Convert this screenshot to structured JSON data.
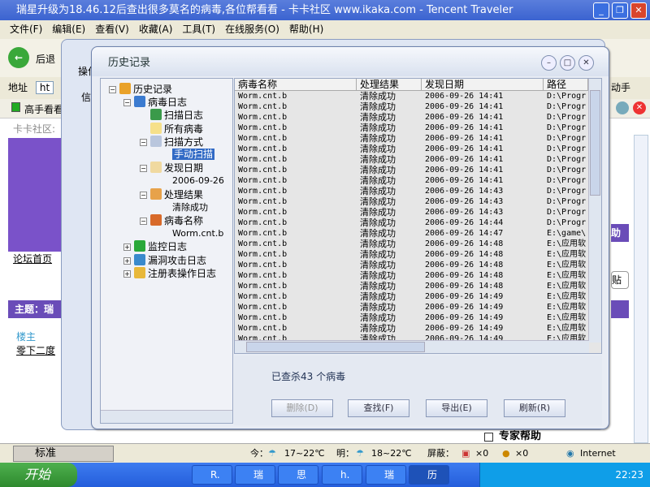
{
  "browser": {
    "title": "瑞星升级为18.46.12后查出很多莫名的病毒,各位帮看看 - 卡卡社区 www.ikaka.com - Tencent Traveler",
    "menu": [
      "文件(F)",
      "编辑(E)",
      "查看(V)",
      "收藏(A)",
      "工具(T)",
      "在线服务(O)",
      "帮助(H)"
    ],
    "back_label": "后退",
    "address_label": "地址",
    "address_value": "ht",
    "tab_label": "高手看看",
    "breadcrumb": "卡卡社区:",
    "forum_home": "论坛首页",
    "topic_label": "主题：瑞",
    "author_role": "楼主",
    "author_name": "零下二度",
    "right_text": "动手",
    "help_text": "助",
    "post_text": "贴",
    "expert_help": "专家帮助",
    "behind_tab": "信",
    "behind_menu": "操作"
  },
  "dialog": {
    "title": "历史记录",
    "tree": [
      {
        "label": "历史记录",
        "icon": "history-icon",
        "expander": "−"
      },
      {
        "label": "病毒日志",
        "icon": "virus-log-icon",
        "expander": "−"
      },
      {
        "label": "扫描日志",
        "icon": "scan-log-icon"
      },
      {
        "label": "所有病毒",
        "icon": "all-virus-icon"
      },
      {
        "label": "扫描方式",
        "icon": "scan-mode-icon",
        "expander": "−"
      },
      {
        "label": "手动扫描",
        "selected": true
      },
      {
        "label": "发现日期",
        "icon": "date-icon",
        "expander": "−"
      },
      {
        "label": "2006-09-26"
      },
      {
        "label": "处理结果",
        "icon": "result-icon",
        "expander": "−"
      },
      {
        "label": "清除成功"
      },
      {
        "label": "病毒名称",
        "icon": "virus-name-icon",
        "expander": "−"
      },
      {
        "label": "Worm.cnt.b"
      },
      {
        "label": "监控日志",
        "icon": "umbrella-icon",
        "expander": "+"
      },
      {
        "label": "漏洞攻击日志",
        "icon": "exploit-icon",
        "expander": "+"
      },
      {
        "label": "注册表操作日志",
        "icon": "registry-icon",
        "expander": "+"
      }
    ],
    "columns": [
      "病毒名称",
      "处理结果",
      "发现日期",
      "路径"
    ],
    "rows": [
      [
        "Worm.cnt.b",
        "清除成功",
        "2006-09-26 14:41",
        "D:\\Progr"
      ],
      [
        "Worm.cnt.b",
        "清除成功",
        "2006-09-26 14:41",
        "D:\\Progr"
      ],
      [
        "Worm.cnt.b",
        "清除成功",
        "2006-09-26 14:41",
        "D:\\Progr"
      ],
      [
        "Worm.cnt.b",
        "清除成功",
        "2006-09-26 14:41",
        "D:\\Progr"
      ],
      [
        "Worm.cnt.b",
        "清除成功",
        "2006-09-26 14:41",
        "D:\\Progr"
      ],
      [
        "Worm.cnt.b",
        "清除成功",
        "2006-09-26 14:41",
        "D:\\Progr"
      ],
      [
        "Worm.cnt.b",
        "清除成功",
        "2006-09-26 14:41",
        "D:\\Progr"
      ],
      [
        "Worm.cnt.b",
        "清除成功",
        "2006-09-26 14:41",
        "D:\\Progr"
      ],
      [
        "Worm.cnt.b",
        "清除成功",
        "2006-09-26 14:41",
        "D:\\Progr"
      ],
      [
        "Worm.cnt.b",
        "清除成功",
        "2006-09-26 14:43",
        "D:\\Progr"
      ],
      [
        "Worm.cnt.b",
        "清除成功",
        "2006-09-26 14:43",
        "D:\\Progr"
      ],
      [
        "Worm.cnt.b",
        "清除成功",
        "2006-09-26 14:43",
        "D:\\Progr"
      ],
      [
        "Worm.cnt.b",
        "清除成功",
        "2006-09-26 14:44",
        "D:\\Progr"
      ],
      [
        "Worm.cnt.b",
        "清除成功",
        "2006-09-26 14:47",
        "E:\\game\\"
      ],
      [
        "Worm.cnt.b",
        "清除成功",
        "2006-09-26 14:48",
        "E:\\应用软"
      ],
      [
        "Worm.cnt.b",
        "清除成功",
        "2006-09-26 14:48",
        "E:\\应用软"
      ],
      [
        "Worm.cnt.b",
        "清除成功",
        "2006-09-26 14:48",
        "E:\\应用软"
      ],
      [
        "Worm.cnt.b",
        "清除成功",
        "2006-09-26 14:48",
        "E:\\应用软"
      ],
      [
        "Worm.cnt.b",
        "清除成功",
        "2006-09-26 14:48",
        "E:\\应用软"
      ],
      [
        "Worm.cnt.b",
        "清除成功",
        "2006-09-26 14:49",
        "E:\\应用软"
      ],
      [
        "Worm.cnt.b",
        "清除成功",
        "2006-09-26 14:49",
        "E:\\应用软"
      ],
      [
        "Worm.cnt.b",
        "清除成功",
        "2006-09-26 14:49",
        "E:\\应用软"
      ],
      [
        "Worm.cnt.b",
        "清除成功",
        "2006-09-26 14:49",
        "E:\\应用软"
      ],
      [
        "Worm.cnt.b",
        "清除成功",
        "2006-09-26 14:49",
        "E:\\应用软"
      ]
    ],
    "summary": "已查杀43 个病毒",
    "buttons": {
      "delete": "删除(D)",
      "find": "查找(F)",
      "export": "导出(E)",
      "refresh": "刷新(R)"
    }
  },
  "statusbar": {
    "ime": "标准",
    "today": "今：",
    "today_temp": "17~22℃",
    "tomorrow": "明：",
    "tomorrow_temp": "18~22℃",
    "block_label": "屏蔽：",
    "block1": "×0",
    "block2": "×0",
    "zone": "Internet"
  },
  "taskbar": {
    "start": "开始",
    "items": [
      "R.",
      "瑞",
      "思",
      "h.",
      "瑞",
      "历"
    ],
    "clock": "22:23"
  }
}
